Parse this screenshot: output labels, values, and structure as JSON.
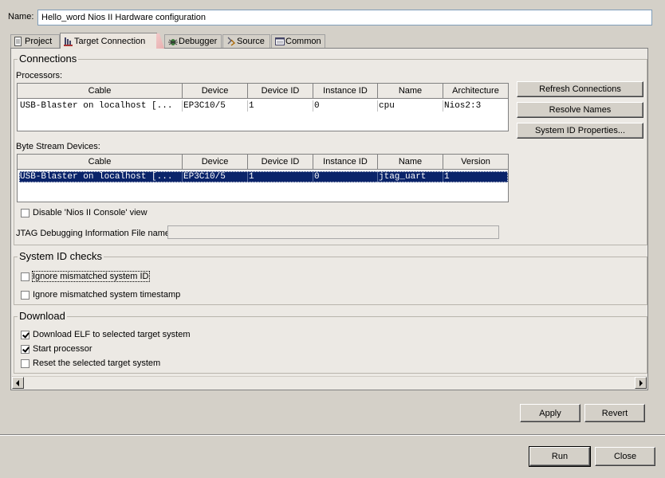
{
  "name_label": "Name:",
  "name_value": "Hello_word Nios II Hardware configuration",
  "tabs": [
    {
      "label": "Project",
      "icon": "page-icon"
    },
    {
      "label": "Target Connection",
      "icon": "target-connection-icon",
      "active": true
    },
    {
      "label": "Debugger",
      "icon": "bug-icon"
    },
    {
      "label": "Source",
      "icon": "source-icon"
    },
    {
      "label": "Common",
      "icon": "common-icon"
    }
  ],
  "connections": {
    "title": "Connections",
    "processors_label": "Processors:",
    "processors_columns": [
      "Cable",
      "Device",
      "Device ID",
      "Instance ID",
      "Name",
      "Architecture"
    ],
    "processors_rows": [
      [
        "USB-Blaster on localhost [...",
        "EP3C10/5",
        "1",
        "0",
        "cpu",
        "Nios2:3"
      ]
    ],
    "byte_stream_label": "Byte Stream Devices:",
    "byte_stream_columns": [
      "Cable",
      "Device",
      "Device ID",
      "Instance ID",
      "Name",
      "Version"
    ],
    "byte_stream_rows": [
      [
        "USB-Blaster on localhost [...",
        "EP3C10/5",
        "1",
        "0",
        "jtag_uart",
        "1"
      ]
    ],
    "disable_console_label": "Disable 'Nios II Console' view",
    "jtag_label": "JTAG Debugging Information File name:",
    "jtag_value": "",
    "refresh_button": "Refresh Connections",
    "resolve_button": "Resolve Names",
    "sysid_button": "System ID Properties..."
  },
  "system_id": {
    "title": "System ID checks",
    "ignore_id_label": "Ignore mismatched system ID",
    "ignore_timestamp_label": "Ignore mismatched system timestamp"
  },
  "download": {
    "title": "Download",
    "download_elf_label": "Download ELF to selected target system",
    "start_processor_label": "Start processor",
    "reset_label": "Reset the selected target system"
  },
  "buttons": {
    "apply": "Apply",
    "revert": "Revert",
    "run": "Run",
    "close": "Close"
  }
}
